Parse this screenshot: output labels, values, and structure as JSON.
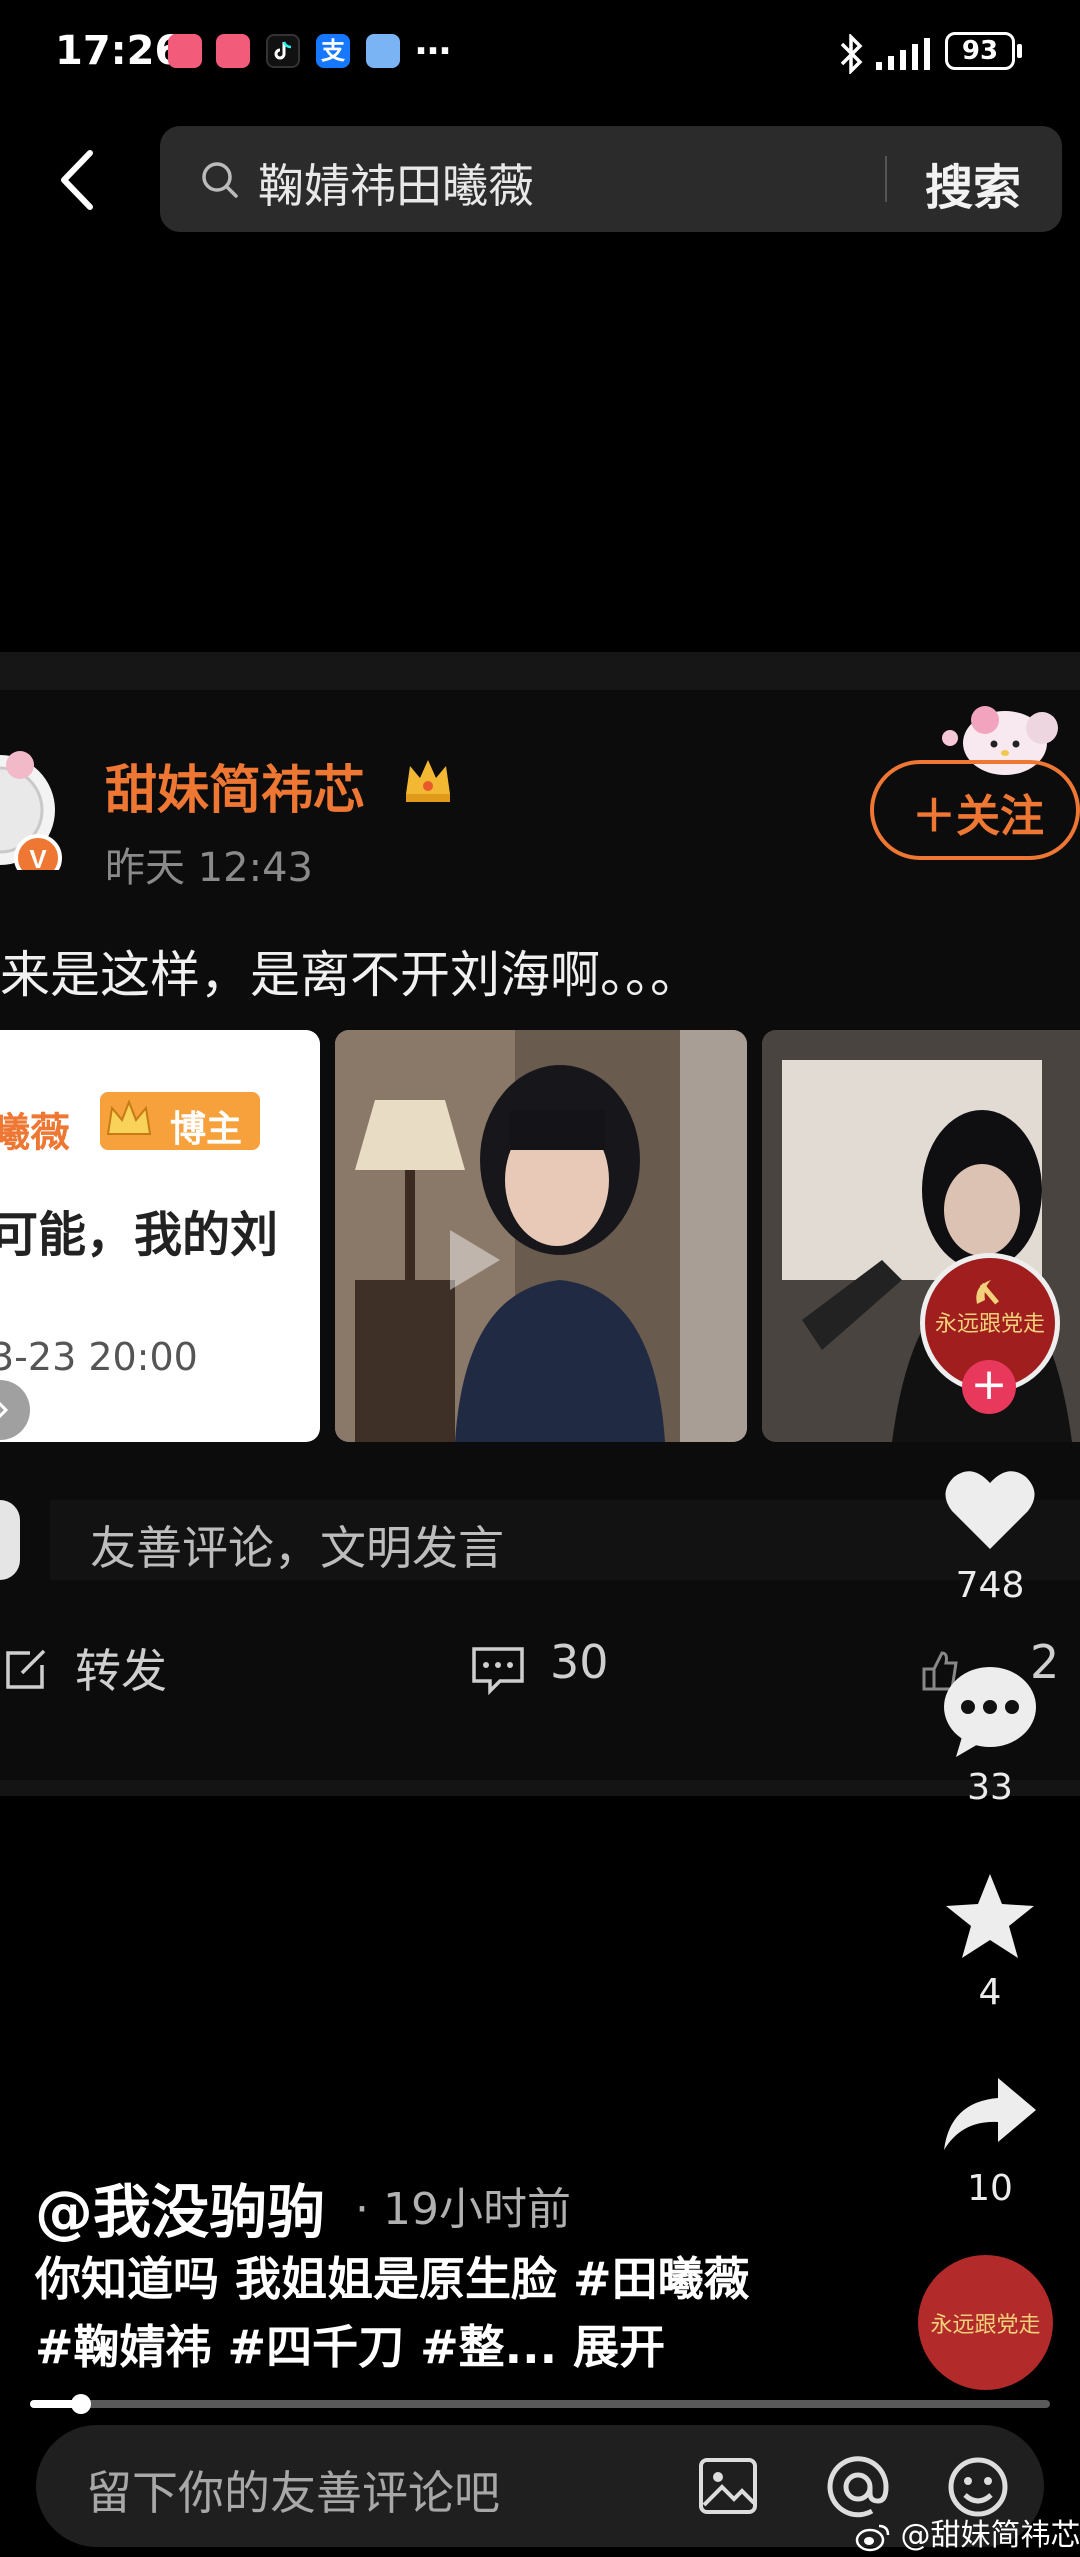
{
  "status_bar": {
    "time": "17:26",
    "overflow": "…",
    "battery": "93",
    "icons": [
      "app-icon",
      "app-icon",
      "tiktok-icon",
      "alipay-icon",
      "app-icon",
      "bluetooth-icon",
      "signal-icon"
    ]
  },
  "search": {
    "query": "鞠婧祎田曦薇",
    "button": "搜索"
  },
  "post": {
    "username": "甜妹简祎芯",
    "time": "昨天 12:43",
    "follow_label": "＋关注",
    "text": "来是这样，是离不开刘海啊。。。",
    "thumbnail1": {
      "line1": "曦薇",
      "badge": "博主",
      "line2": "可能，我的刘",
      "line3": "3-23 20:00"
    },
    "comment_placeholder": "友善评论，文明发言",
    "repost_label": "转发",
    "comment_count": "30",
    "like_count": "2"
  },
  "rail": {
    "party_text": "永远跟党走",
    "plus": "+",
    "likes": "748",
    "comments": "33",
    "favorites": "4",
    "shares": "10"
  },
  "video": {
    "author": "@我没驹驹",
    "age": "· 19小时前",
    "desc": "你知道吗 我姐姐是原生脸 #田曦薇 #鞠婧祎 #四千刀 #整...",
    "expand": "展开",
    "progress": 0.05
  },
  "input": {
    "placeholder": "留下你的友善评论吧"
  },
  "floating_badge_text": "永远跟党走",
  "watermark": "@甜妹简祎芯",
  "colors": {
    "accent": "#ee7733",
    "background": "#000000",
    "party_red": "#a01e1e"
  }
}
